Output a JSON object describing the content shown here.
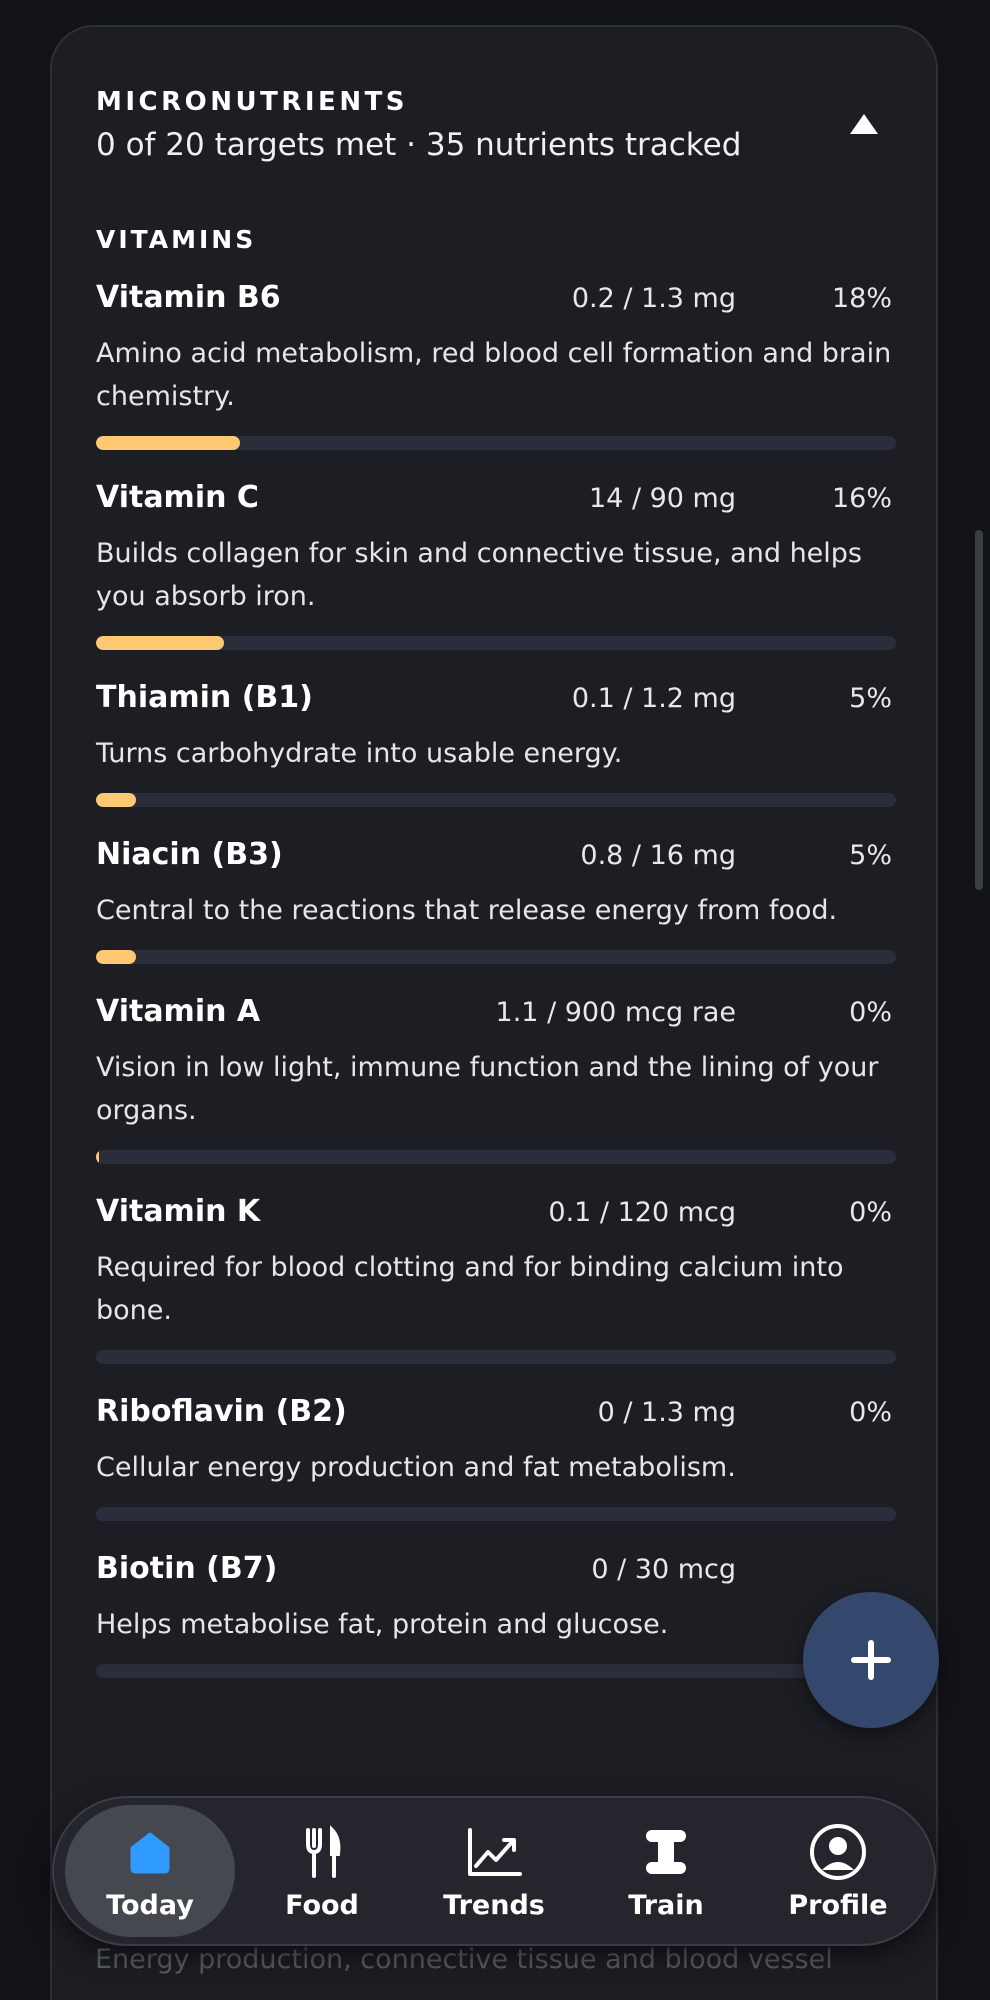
{
  "micronutrients": {
    "title": "MICRONUTRIENTS",
    "summary": "0 of 20 targets met · 35 nutrients tracked",
    "group_title": "VITAMINS",
    "items": [
      {
        "name": "Vitamin B6",
        "amount": "0.2 / 1.3 mg",
        "percent": "18%",
        "fill": 0.18,
        "description": "Amino acid metabolism, red blood cell formation and brain chemistry."
      },
      {
        "name": "Vitamin C",
        "amount": "14 / 90 mg",
        "percent": "16%",
        "fill": 0.16,
        "description": "Builds collagen for skin and connective tissue, and helps you absorb iron."
      },
      {
        "name": "Thiamin (B1)",
        "amount": "0.1 / 1.2 mg",
        "percent": "5%",
        "fill": 0.05,
        "description": "Turns carbohydrate into usable energy."
      },
      {
        "name": "Niacin (B3)",
        "amount": "0.8 / 16 mg",
        "percent": "5%",
        "fill": 0.05,
        "description": "Central to the reactions that release energy from food."
      },
      {
        "name": "Vitamin A",
        "amount": "1.1 / 900 mcg rae",
        "percent": "0%",
        "fill": 0.001,
        "description": "Vision in low light, immune function and the lining of your organs."
      },
      {
        "name": "Vitamin K",
        "amount": "0.1 / 120 mcg",
        "percent": "0%",
        "fill": 0.0,
        "description": "Required for blood clotting and for binding calcium into bone."
      },
      {
        "name": "Riboflavin (B2)",
        "amount": "0 / 1.3 mg",
        "percent": "0%",
        "fill": 0.0,
        "description": "Cellular energy production and fat metabolism."
      },
      {
        "name": "Biotin (B7)",
        "amount": "0 / 30 mcg",
        "percent": "",
        "fill": 0.0,
        "description": "Helps metabolise fat, protein and glucose."
      }
    ],
    "faded_description": "Energy production, connective tissue and blood vessel"
  },
  "nav": {
    "items": [
      {
        "label": "Today",
        "icon": "home-icon",
        "active": true
      },
      {
        "label": "Food",
        "icon": "fork-knife-icon",
        "active": false
      },
      {
        "label": "Trends",
        "icon": "trend-chart-icon",
        "active": false
      },
      {
        "label": "Train",
        "icon": "dumbbell-icon",
        "active": false
      },
      {
        "label": "Profile",
        "icon": "user-circle-icon",
        "active": false
      }
    ]
  },
  "colors": {
    "accent_bar": "#ffc872",
    "active_home_icon": "#2f9bff",
    "fab": "#34486e"
  }
}
